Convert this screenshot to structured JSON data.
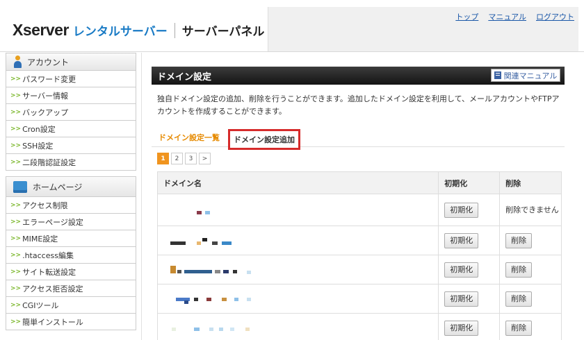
{
  "header": {
    "brand": "Xserver",
    "product": "レンタルサーバー",
    "panel": "サーバーパネル",
    "links": [
      "トップ",
      "マニュアル",
      "ログアウト"
    ]
  },
  "sidebar": {
    "account": {
      "title": "アカウント",
      "items": [
        "パスワード変更",
        "サーバー情報",
        "バックアップ",
        "Cron設定",
        "SSH設定",
        "二段階認証設定"
      ]
    },
    "homepage": {
      "title": "ホームページ",
      "items": [
        "アクセス制限",
        "エラーページ設定",
        "MIME設定",
        ".htaccess編集",
        "サイト転送設定",
        "アクセス拒否設定",
        "CGIツール",
        "簡単インストール"
      ]
    }
  },
  "main": {
    "title": "ドメイン設定",
    "manual_button": "関連マニュアル",
    "description": "独自ドメイン設定の追加、削除を行うことができます。追加したドメイン設定を利用して、メールアカウントやFTPアカウントを作成することができます。",
    "tabs": [
      "ドメイン設定一覧",
      "ドメイン設定追加"
    ],
    "pages": [
      "1",
      "2",
      "3",
      ">"
    ],
    "table": {
      "columns": [
        "ドメイン名",
        "初期化",
        "削除"
      ],
      "reset_label": "初期化",
      "delete_label": "削除",
      "undeletable_note": "削除できません"
    }
  },
  "colors": {
    "accent_orange": "#f0941f",
    "highlight_red": "#d62b2b",
    "brand_blue": "#1a7bc5",
    "link_blue": "#1a57a8"
  }
}
